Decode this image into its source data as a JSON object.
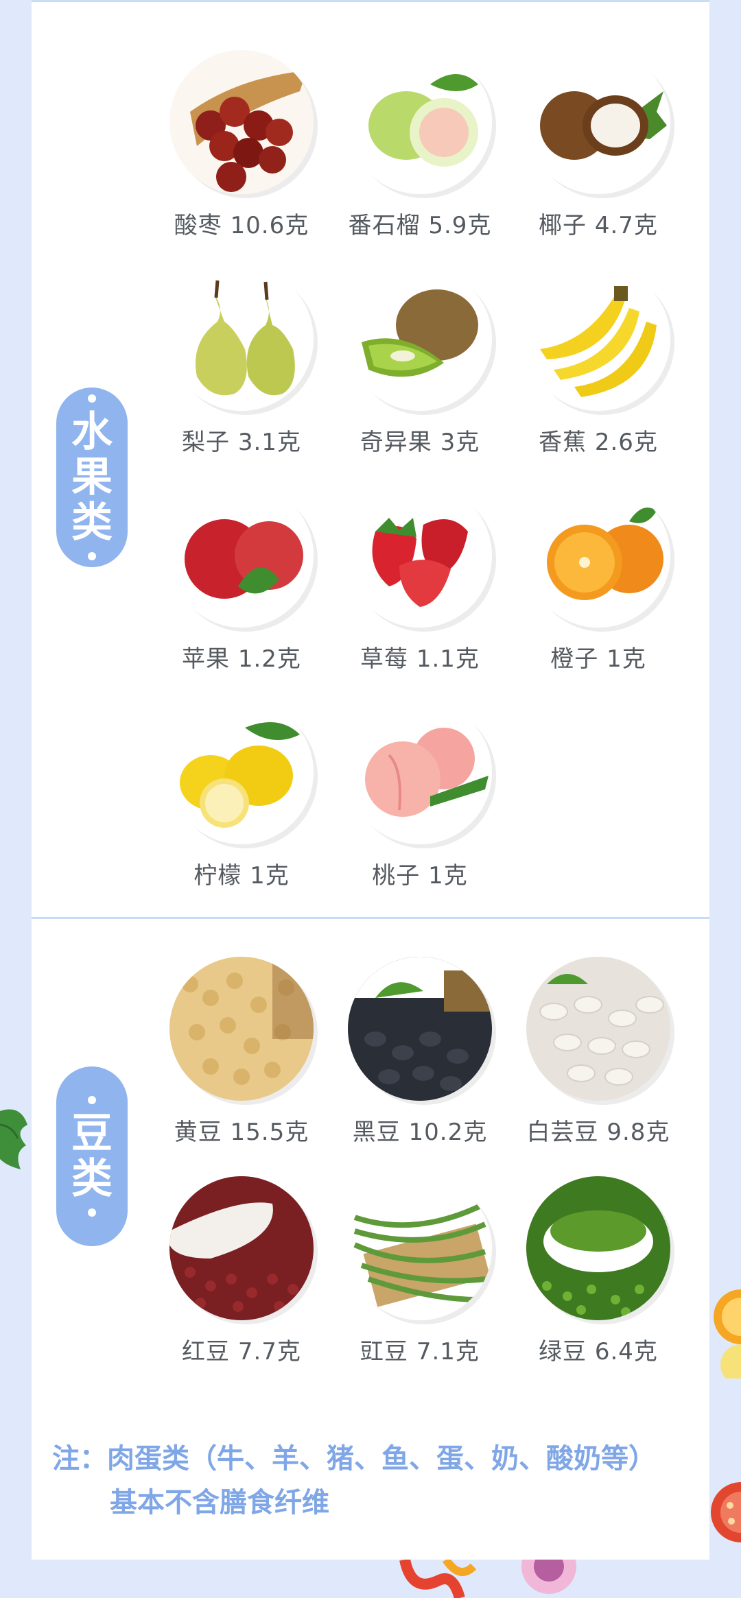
{
  "categories": {
    "fruit": {
      "name_chars": [
        "水",
        "果",
        "类"
      ]
    },
    "beans": {
      "name_chars": [
        "豆",
        "类"
      ]
    }
  },
  "fruits": [
    {
      "name": "酸枣",
      "amount": "10.6克",
      "label": "酸枣 10.6克",
      "icon": "jujube-icon"
    },
    {
      "name": "番石榴",
      "amount": "5.9克",
      "label": "番石榴 5.9克",
      "icon": "guava-icon"
    },
    {
      "name": "椰子",
      "amount": "4.7克",
      "label": "椰子 4.7克",
      "icon": "coconut-icon"
    },
    {
      "name": "梨子",
      "amount": "3.1克",
      "label": "梨子 3.1克",
      "icon": "pear-icon"
    },
    {
      "name": "奇异果",
      "amount": "3克",
      "label": "奇异果 3克",
      "icon": "kiwi-icon"
    },
    {
      "name": "香蕉",
      "amount": "2.6克",
      "label": "香蕉 2.6克",
      "icon": "banana-icon"
    },
    {
      "name": "苹果",
      "amount": "1.2克",
      "label": "苹果 1.2克",
      "icon": "apple-icon"
    },
    {
      "name": "草莓",
      "amount": "1.1克",
      "label": "草莓 1.1克",
      "icon": "strawberry-icon"
    },
    {
      "name": "橙子",
      "amount": "1克",
      "label": "橙子 1克",
      "icon": "orange-icon"
    },
    {
      "name": "柠檬",
      "amount": "1克",
      "label": "柠檬 1克",
      "icon": "lemon-icon"
    },
    {
      "name": "桃子",
      "amount": "1克",
      "label": "桃子 1克",
      "icon": "peach-icon"
    }
  ],
  "beans": [
    {
      "name": "黄豆",
      "amount": "15.5克",
      "label": "黄豆 15.5克",
      "icon": "soybean-icon"
    },
    {
      "name": "黑豆",
      "amount": "10.2克",
      "label": "黑豆 10.2克",
      "icon": "black-bean-icon"
    },
    {
      "name": "白芸豆",
      "amount": "9.8克",
      "label": "白芸豆 9.8克",
      "icon": "white-kidney-bean-icon"
    },
    {
      "name": "红豆",
      "amount": "7.7克",
      "label": "红豆 7.7克",
      "icon": "red-bean-icon"
    },
    {
      "name": "豇豆",
      "amount": "7.1克",
      "label": "豇豆 7.1克",
      "icon": "cowpea-icon"
    },
    {
      "name": "绿豆",
      "amount": "6.4克",
      "label": "绿豆 6.4克",
      "icon": "mung-bean-icon"
    }
  ],
  "note": {
    "line1": "注：肉蛋类（牛、羊、猪、鱼、蛋、奶、酸奶等）",
    "line2": "基本不含膳食纤维"
  },
  "colors": {
    "background": "#dfe9fb",
    "pill": "#8fb4ee",
    "note_text": "#7fa6e6",
    "label_text": "#555a60"
  }
}
